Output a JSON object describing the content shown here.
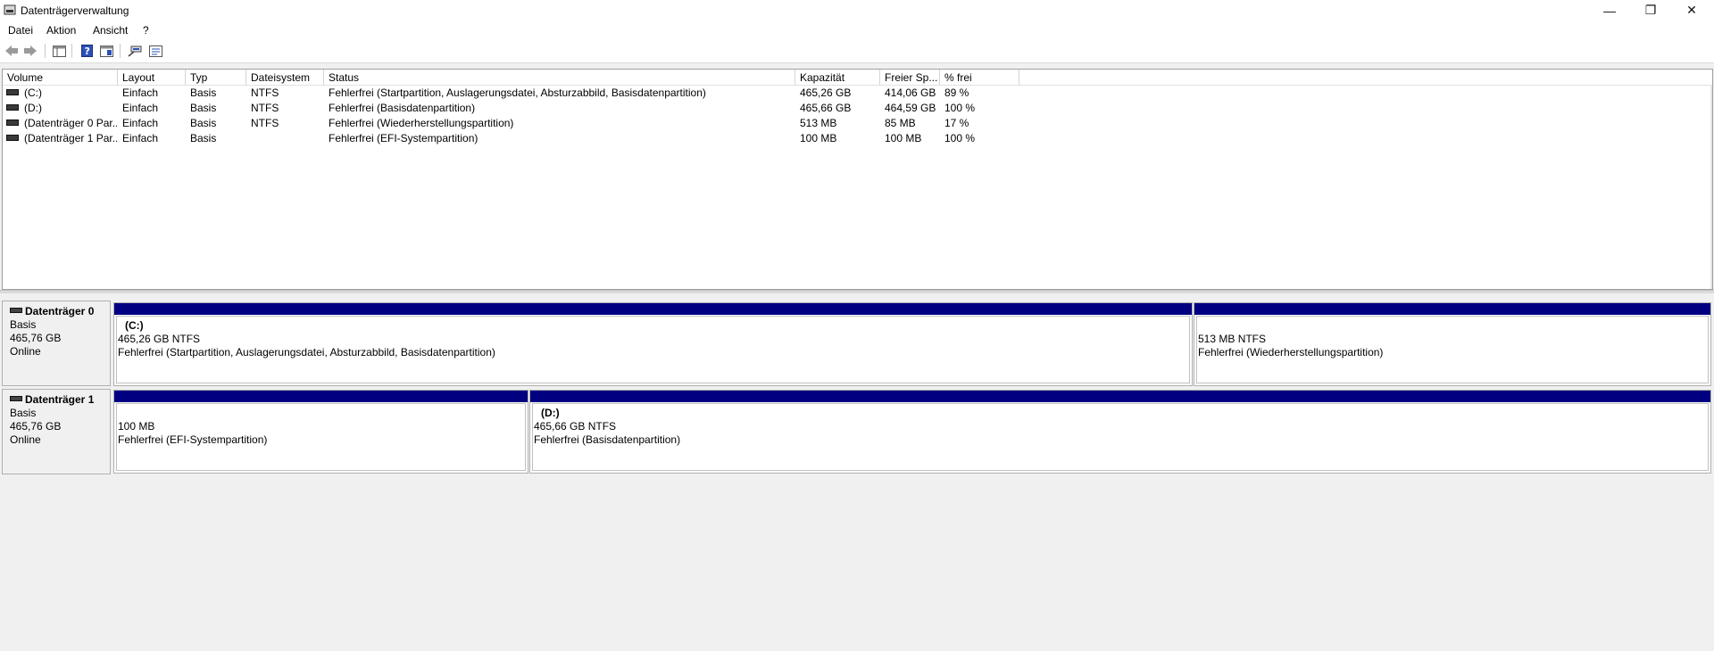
{
  "window": {
    "title": "Datenträgerverwaltung",
    "minimize": "—",
    "maximize": "❐",
    "close": "✕"
  },
  "menu": [
    "Datei",
    "Aktion",
    "Ansicht",
    "?"
  ],
  "toolbar": {
    "icons": [
      "back-arrow-icon",
      "forward-arrow-icon",
      "console-tree-icon",
      "help-icon",
      "properties-icon",
      "connect-icon",
      "view-icon"
    ]
  },
  "list": {
    "columns": [
      "Volume",
      "Layout",
      "Typ",
      "Dateisystem",
      "Status",
      "Kapazität",
      "Freier Sp...",
      "% frei"
    ],
    "rows": [
      [
        "(C:)",
        "Einfach",
        "Basis",
        "NTFS",
        "Fehlerfrei (Startpartition, Auslagerungsdatei, Absturzabbild, Basisdatenpartition)",
        "465,26 GB",
        "414,06 GB",
        "89 %"
      ],
      [
        "(D:)",
        "Einfach",
        "Basis",
        "NTFS",
        "Fehlerfrei (Basisdatenpartition)",
        "465,66 GB",
        "464,59 GB",
        "100 %"
      ],
      [
        "(Datenträger 0 Par...",
        "Einfach",
        "Basis",
        "NTFS",
        "Fehlerfrei (Wiederherstellungspartition)",
        "513 MB",
        "85 MB",
        "17 %"
      ],
      [
        "(Datenträger 1 Par...",
        "Einfach",
        "Basis",
        "",
        "Fehlerfrei (EFI-Systempartition)",
        "100 MB",
        "100 MB",
        "100 %"
      ]
    ]
  },
  "disks": [
    {
      "name": "Datenträger 0",
      "type": "Basis",
      "size": "465,76 GB",
      "state": "Online",
      "partitions": [
        {
          "label": "(C:)",
          "size": "465,26 GB NTFS",
          "status": "Fehlerfrei (Startpartition, Auslagerungsdatei, Absturzabbild, Basisdatenpartition)"
        },
        {
          "label": "",
          "size": "513 MB NTFS",
          "status": "Fehlerfrei (Wiederherstellungspartition)"
        }
      ]
    },
    {
      "name": "Datenträger 1",
      "type": "Basis",
      "size": "465,76 GB",
      "state": "Online",
      "partitions": [
        {
          "label": "",
          "size": "100 MB",
          "status": "Fehlerfrei (EFI-Systempartition)"
        },
        {
          "label": "(D:)",
          "size": "465,66 GB NTFS",
          "status": "Fehlerfrei (Basisdatenpartition)"
        }
      ]
    }
  ],
  "colors": {
    "partition_bar": "#000080",
    "background": "#f0f0f0"
  }
}
